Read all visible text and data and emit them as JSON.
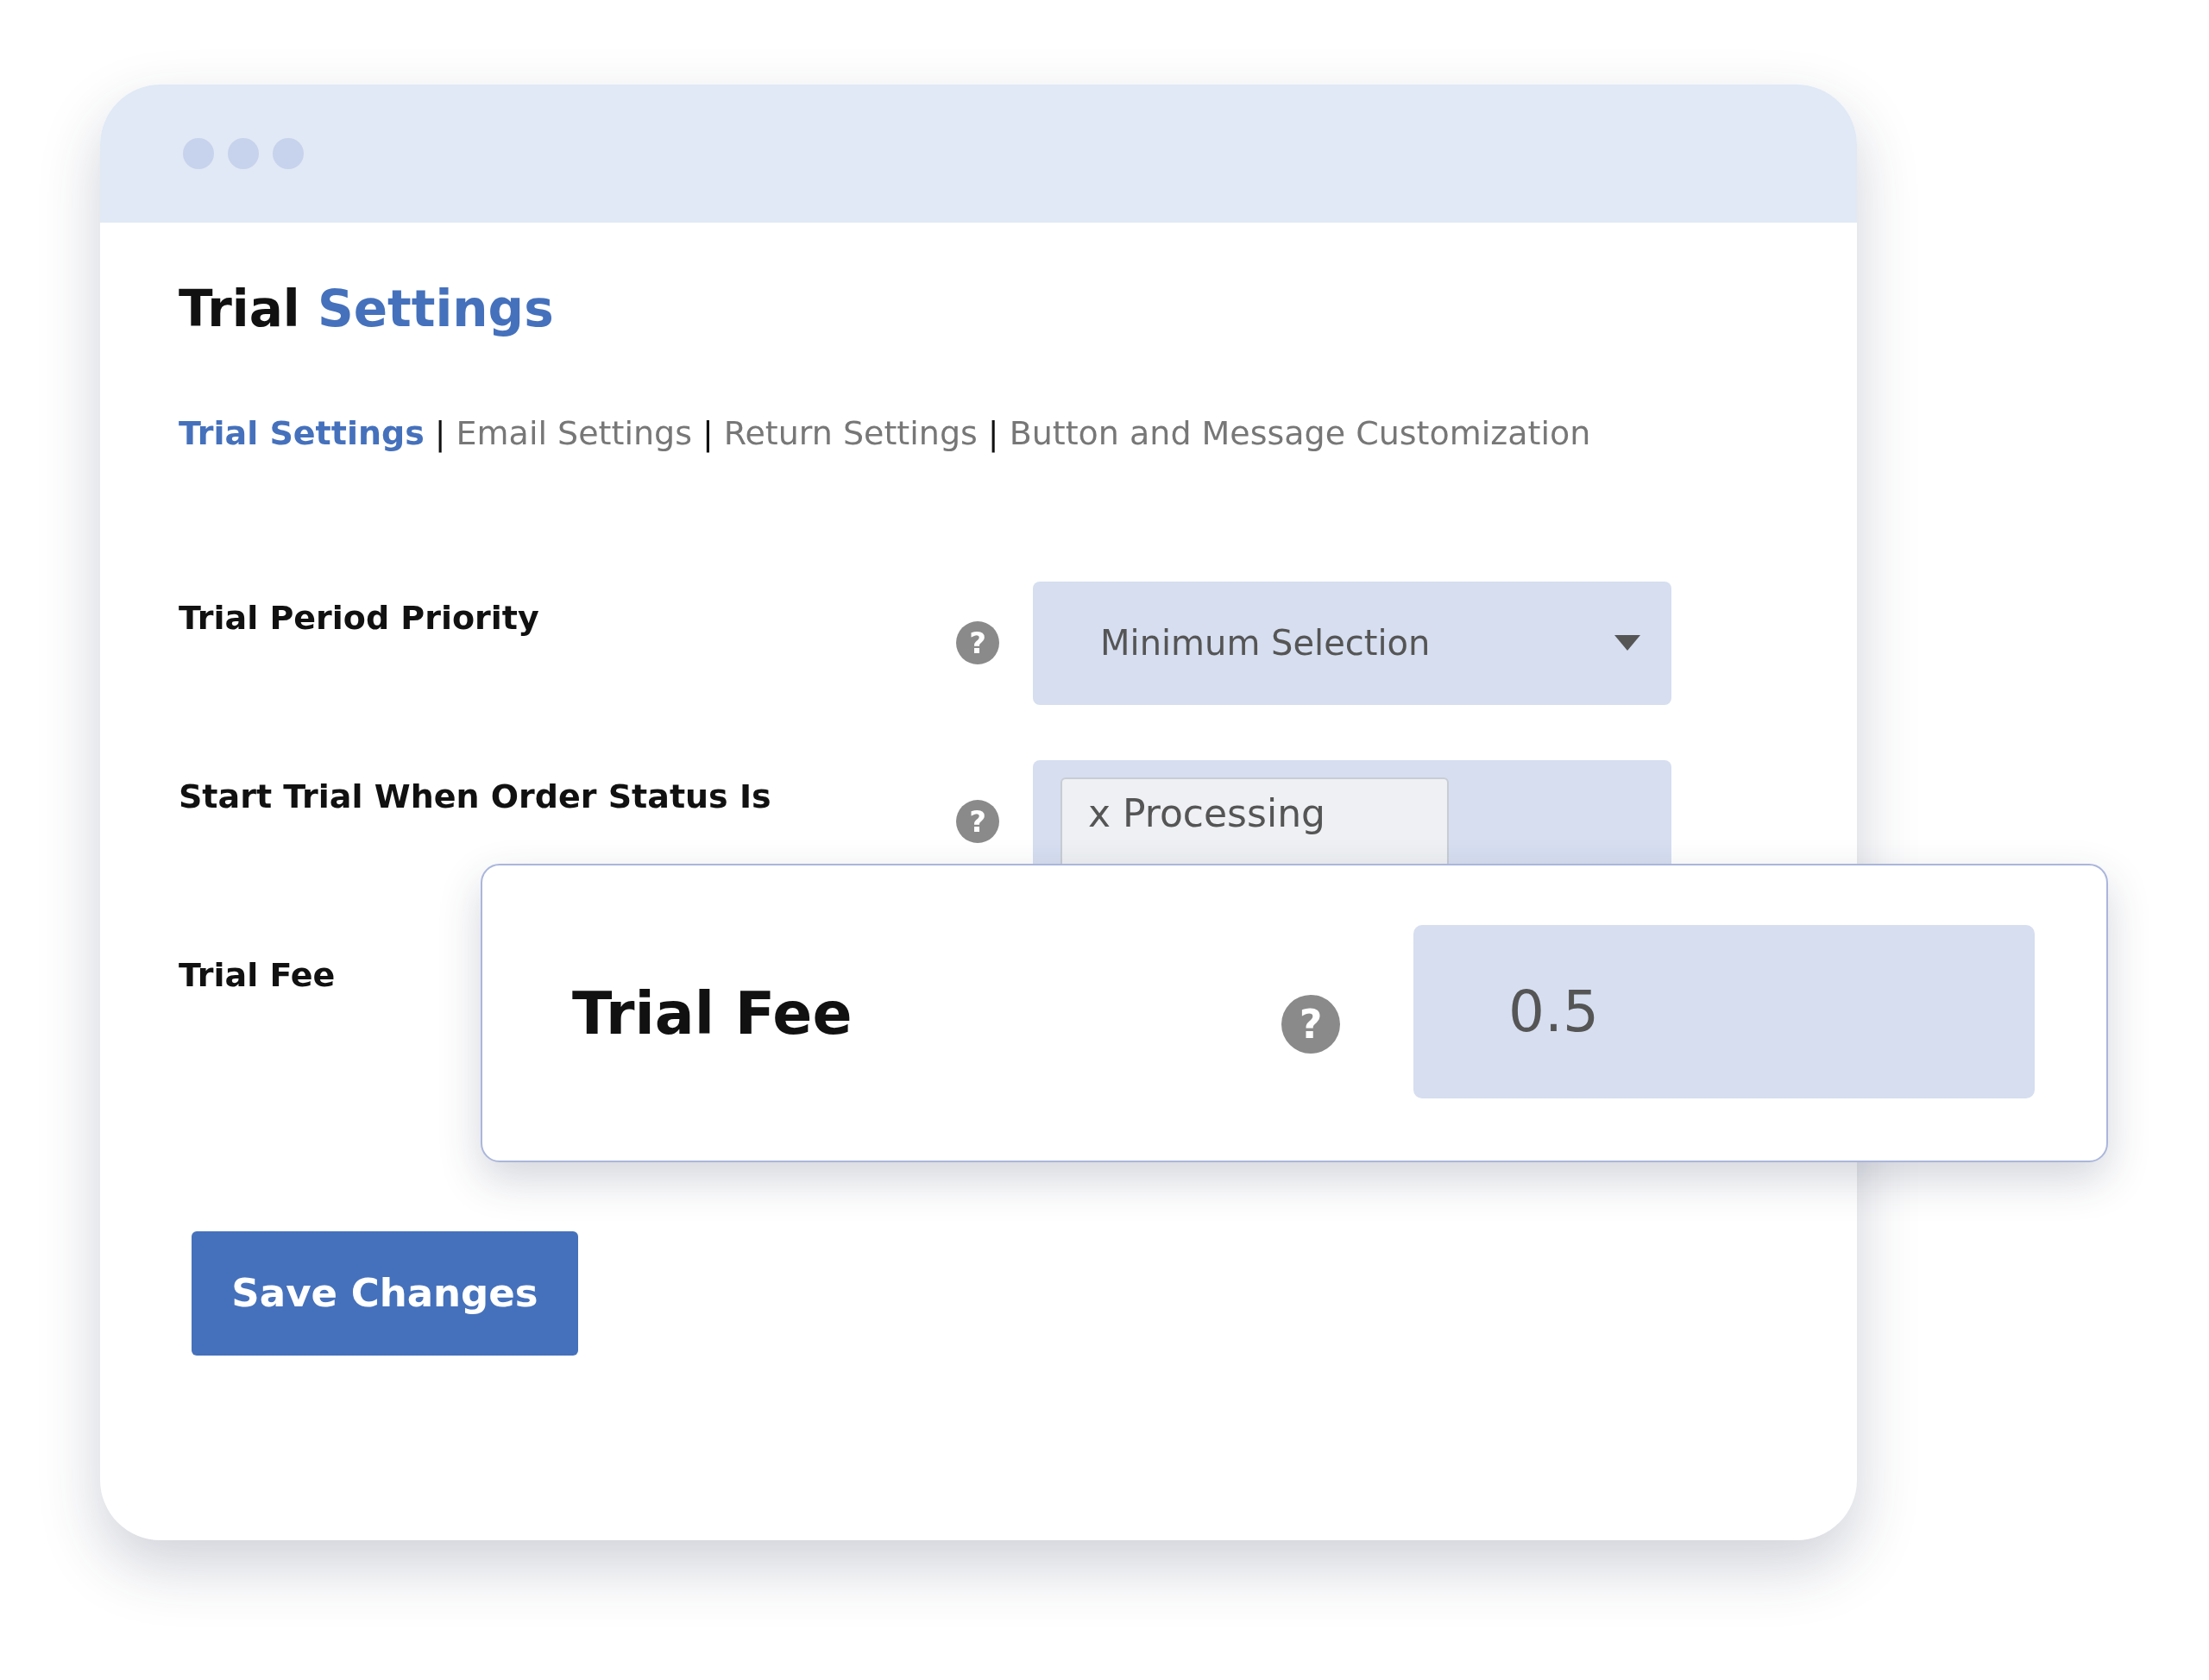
{
  "heading": {
    "lead": "Trial",
    "accent": "Settings"
  },
  "tabs": [
    {
      "label": "Trial Settings",
      "selected": true
    },
    {
      "separator": "|",
      "label": "Email Settings",
      "selected": false
    },
    {
      "separator": "|",
      "label": "Return Settings",
      "selected": false
    },
    {
      "separator": "|",
      "label": "Button and Message Customization",
      "selected": false
    }
  ],
  "fields": [
    {
      "kind": "select",
      "label": "Trial Period Priority",
      "help": "?",
      "value": "Minimum Selection"
    },
    {
      "kind": "tags",
      "label": "Start Trial When Order Status Is",
      "help": "?",
      "tags": [
        "x Processing"
      ]
    },
    {
      "kind": "covered",
      "label": "Trial Fee"
    }
  ],
  "callout": {
    "label": "Trial Fee",
    "help": "?",
    "value": "0.5"
  },
  "save_button": "Save Changes"
}
